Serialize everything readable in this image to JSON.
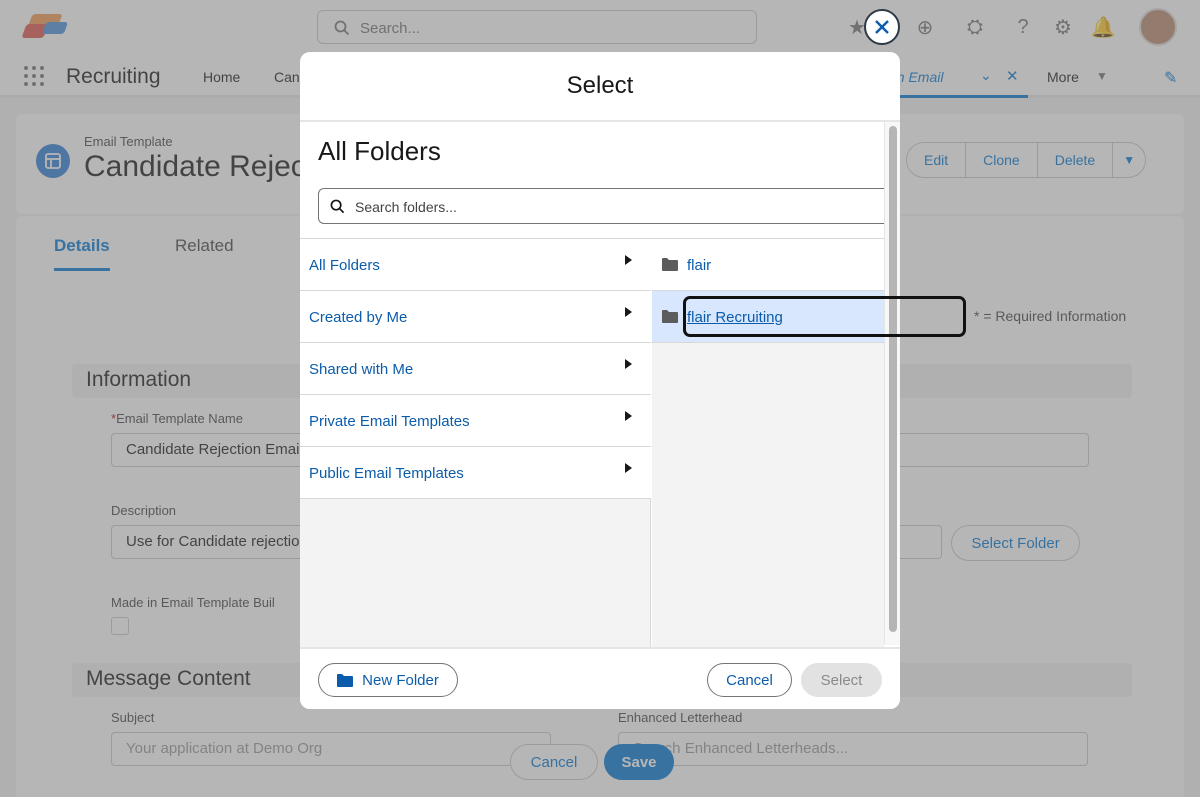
{
  "top": {
    "search_placeholder": "Search...",
    "icons": [
      "favorites-icon",
      "add-icon",
      "setup-assistant-icon",
      "help-icon",
      "gear-icon",
      "bell-icon",
      "avatar"
    ]
  },
  "nav": {
    "app_name": "Recruiting",
    "items": [
      "Home",
      "Can"
    ],
    "active_tab_label": "tion Email",
    "more_label": "More"
  },
  "record": {
    "type": "Email Template",
    "title": "Candidate Rejec",
    "actions": [
      "Edit",
      "Clone",
      "Delete"
    ]
  },
  "details": {
    "tabs": [
      "Details",
      "Related"
    ],
    "required_note": "* = Required Information",
    "section_information": "Information",
    "template_name_label": "Email Template Name",
    "template_name_value": "Candidate Rejection Email",
    "description_label": "Description",
    "description_value": "Use for Candidate rejectio",
    "builder_label": "Made in Email Template Buil",
    "select_folder_label": "Select Folder",
    "section_message": "Message Content",
    "subject_label": "Subject",
    "subject_value": "Your application at Demo Org",
    "letterhead_label": "Enhanced Letterhead",
    "letterhead_placeholder": "Search Enhanced Letterheads...",
    "cancel_label": "Cancel",
    "save_label": "Save"
  },
  "modal": {
    "title": "Select",
    "folders_heading": "All Folders",
    "search_placeholder": "Search folders...",
    "left_items": [
      "All Folders",
      "Created by Me",
      "Shared with Me",
      "Private Email Templates",
      "Public Email Templates"
    ],
    "right_items": [
      "flair",
      "flair Recruiting"
    ],
    "selected_folder": "flair Recruiting",
    "new_folder_label": "New Folder",
    "cancel_label": "Cancel",
    "select_label": "Select"
  },
  "colors": {
    "brand_blue": "#0176d3",
    "link_blue": "#0b5cab",
    "selected_row": "#d8e6fe"
  }
}
